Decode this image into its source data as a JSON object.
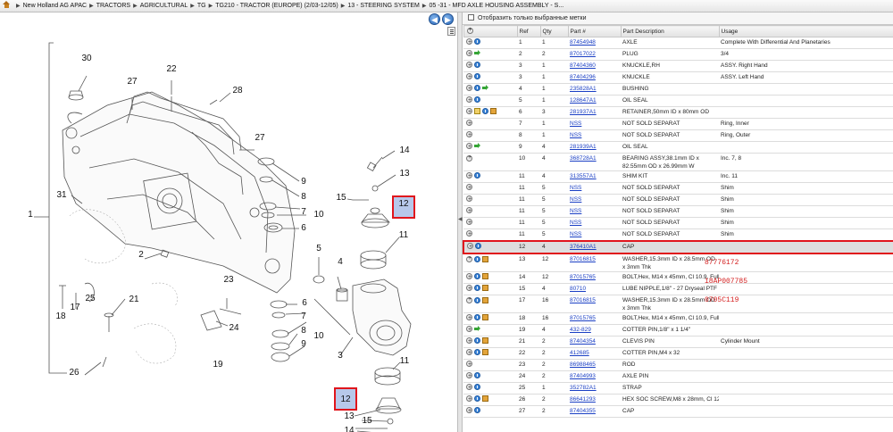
{
  "breadcrumb": [
    "New Holland AG APAC",
    "TRACTORS",
    "AGRICULTURAL",
    "TG",
    "TG210 - TRACTOR (EUROPE) (2/03-12/05)",
    "13 - STEERING SYSTEM",
    "05 -31 - MFD AXLE HOUSING ASSEMBLY - S..."
  ],
  "nav": {
    "back": "◀",
    "forward": "▶"
  },
  "filter": {
    "label": "Отобразить только выбранные метки"
  },
  "table": {
    "headers": [
      "Ref",
      "Qty",
      "Part #",
      "Part Description",
      "Usage"
    ],
    "rows": [
      {
        "icons": [
          "plus",
          "info"
        ],
        "ref": "1",
        "qty": "1",
        "part": "87454948",
        "desc": "AXLE",
        "usage": "Complete With Differential And Planetaries"
      },
      {
        "icons": [
          "plus",
          "arrow"
        ],
        "ref": "2",
        "qty": "2",
        "part": "87017022",
        "desc": "PLUG",
        "usage": "3/4"
      },
      {
        "icons": [
          "plus",
          "info"
        ],
        "ref": "3",
        "qty": "1",
        "part": "87404360",
        "desc": "KNUCKLE,RH",
        "usage": "ASSY. Right Hand"
      },
      {
        "icons": [
          "plus",
          "info"
        ],
        "ref": "3",
        "qty": "1",
        "part": "87404296",
        "desc": "KNUCKLE",
        "usage": "ASSY. Left Hand"
      },
      {
        "icons": [
          "plus",
          "info",
          "arrow"
        ],
        "ref": "4",
        "qty": "1",
        "part": "235828A1",
        "desc": "BUSHING",
        "usage": ""
      },
      {
        "icons": [
          "plus",
          "info"
        ],
        "ref": "5",
        "qty": "1",
        "part": "128647A1",
        "desc": "OIL SEAL",
        "usage": ""
      },
      {
        "icons": [
          "plus",
          "note",
          "info",
          "box"
        ],
        "ref": "6",
        "qty": "3",
        "part": "281937A1",
        "desc": "RETAINER,50mm ID x 80mm OD",
        "usage": ""
      },
      {
        "icons": [
          "plus"
        ],
        "ref": "7",
        "qty": "1",
        "part": "NSS",
        "desc": "NOT SOLD SEPARAT",
        "usage": "Ring, Inner"
      },
      {
        "icons": [
          "plus"
        ],
        "ref": "8",
        "qty": "1",
        "part": "NSS",
        "desc": "NOT SOLD SEPARAT",
        "usage": "Ring, Outer"
      },
      {
        "icons": [
          "plus",
          "arrow"
        ],
        "ref": "9",
        "qty": "4",
        "part": "281939A1",
        "desc": "OIL SEAL",
        "usage": ""
      },
      {
        "icons": [
          "plus"
        ],
        "ref": "10",
        "qty": "4",
        "part": "368728A1",
        "desc": "BEARING ASSY,38.1mm ID x 82.55mm OD x 26.99mm W",
        "usage": "Inc. 7, 8",
        "tall": true
      },
      {
        "icons": [
          "plus",
          "info"
        ],
        "ref": "11",
        "qty": "4",
        "part": "313557A1",
        "desc": "SHIM KIT",
        "usage": "Inc. 11"
      },
      {
        "icons": [
          "plus"
        ],
        "ref": "11",
        "qty": "5",
        "part": "NSS",
        "desc": "NOT SOLD SEPARAT",
        "usage": "Shim"
      },
      {
        "icons": [
          "plus"
        ],
        "ref": "11",
        "qty": "5",
        "part": "NSS",
        "desc": "NOT SOLD SEPARAT",
        "usage": "Shim"
      },
      {
        "icons": [
          "plus"
        ],
        "ref": "11",
        "qty": "5",
        "part": "NSS",
        "desc": "NOT SOLD SEPARAT",
        "usage": "Shim"
      },
      {
        "icons": [
          "plus"
        ],
        "ref": "11",
        "qty": "5",
        "part": "NSS",
        "desc": "NOT SOLD SEPARAT",
        "usage": "Shim"
      },
      {
        "icons": [
          "plus"
        ],
        "ref": "11",
        "qty": "5",
        "part": "NSS",
        "desc": "NOT SOLD SEPARAT",
        "usage": "Shim"
      },
      {
        "icons": [
          "plus",
          "info"
        ],
        "ref": "12",
        "qty": "4",
        "part": "376410A1",
        "desc": "CAP",
        "usage": "",
        "highlight": true
      },
      {
        "icons": [
          "plus",
          "info",
          "box"
        ],
        "ref": "13",
        "qty": "12",
        "part": "87016815",
        "desc": "WASHER,15.3mm ID x 28.5mm OD x 3mm Thk",
        "usage": "",
        "tall": true
      },
      {
        "icons": [
          "plus",
          "info",
          "box"
        ],
        "ref": "14",
        "qty": "12",
        "part": "87015765",
        "desc": "BOLT,Hex, M14 x 45mm, Cl 10.9, Full Thd",
        "usage": ""
      },
      {
        "icons": [
          "plus",
          "info",
          "box"
        ],
        "ref": "15",
        "qty": "4",
        "part": "80710",
        "desc": "LUBE NIPPLE,1/8\" - 27 Dryseal PTF",
        "usage": ""
      },
      {
        "icons": [
          "plus",
          "info",
          "box"
        ],
        "ref": "17",
        "qty": "16",
        "part": "87016815",
        "desc": "WASHER,15.3mm ID x 28.5mm OD x 3mm Thk",
        "usage": "",
        "tall": true
      },
      {
        "icons": [
          "plus",
          "info",
          "box"
        ],
        "ref": "18",
        "qty": "16",
        "part": "87015765",
        "desc": "BOLT,Hex, M14 x 45mm, Cl 10.9, Full Thd",
        "usage": ""
      },
      {
        "icons": [
          "plus",
          "arrow"
        ],
        "ref": "19",
        "qty": "4",
        "part": "432-829",
        "desc": "COTTER PIN,1/8\" x 1 1/4\"",
        "usage": ""
      },
      {
        "icons": [
          "plus",
          "info",
          "box"
        ],
        "ref": "21",
        "qty": "2",
        "part": "87404354",
        "desc": "CLEVIS PIN",
        "usage": "Cylinder Mount"
      },
      {
        "icons": [
          "plus",
          "info",
          "box"
        ],
        "ref": "22",
        "qty": "2",
        "part": "412685",
        "desc": "COTTER PIN,M4 x 32",
        "usage": ""
      },
      {
        "icons": [
          "plus"
        ],
        "ref": "23",
        "qty": "2",
        "part": "86988465",
        "desc": "ROD",
        "usage": ""
      },
      {
        "icons": [
          "plus",
          "info"
        ],
        "ref": "24",
        "qty": "2",
        "part": "87404993",
        "desc": "AXLE PIN",
        "usage": ""
      },
      {
        "icons": [
          "plus",
          "info"
        ],
        "ref": "25",
        "qty": "1",
        "part": "352782A1",
        "desc": "STRAP",
        "usage": ""
      },
      {
        "icons": [
          "plus",
          "info",
          "box"
        ],
        "ref": "26",
        "qty": "2",
        "part": "86641293",
        "desc": "HEX SOC SCREW,M8 x 28mm, Cl 12.9",
        "usage": ""
      },
      {
        "icons": [
          "plus",
          "info"
        ],
        "ref": "27",
        "qty": "2",
        "part": "87404355",
        "desc": "CAP",
        "usage": ""
      }
    ]
  },
  "annotations": [
    "87776172",
    "18AP007785",
    "0705C119"
  ],
  "callouts": [
    "1",
    "2",
    "3",
    "4",
    "5",
    "6",
    "7",
    "8",
    "9",
    "10",
    "11",
    "12",
    "13",
    "14",
    "15",
    "17",
    "18",
    "19",
    "21",
    "22",
    "23",
    "24",
    "25",
    "26",
    "27",
    "28",
    "29",
    "30",
    "31"
  ]
}
